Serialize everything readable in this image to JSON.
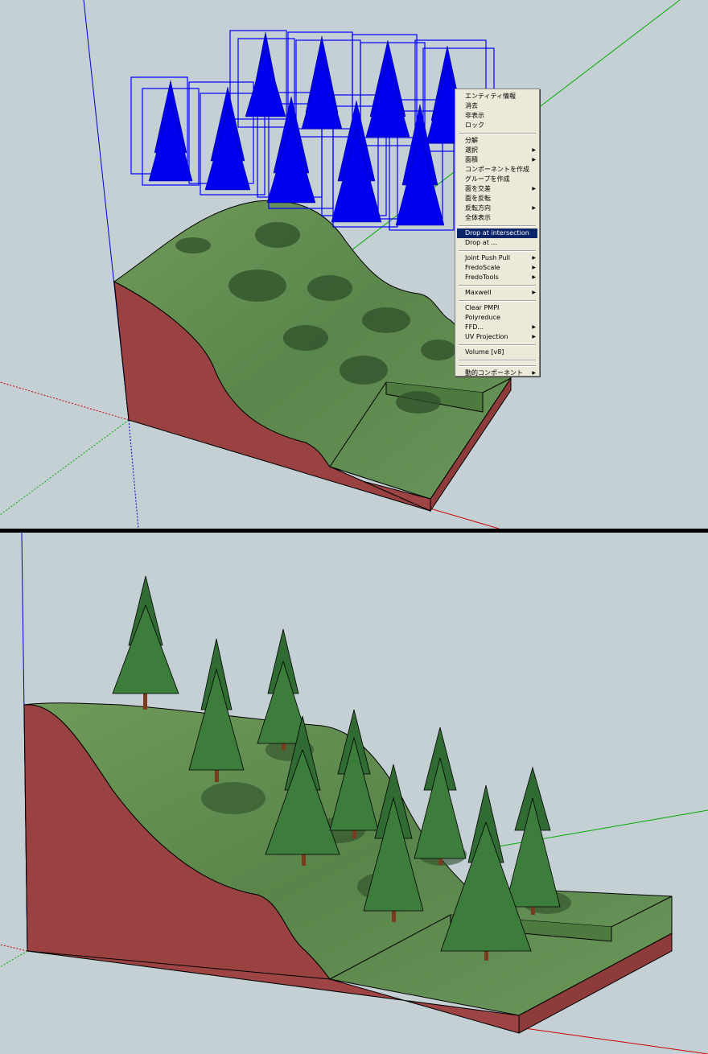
{
  "context_menu": {
    "groups": [
      [
        {
          "label": "エンティティ情報",
          "submenu": false
        },
        {
          "label": "消去",
          "submenu": false
        },
        {
          "label": "非表示",
          "submenu": false
        },
        {
          "label": "ロック",
          "submenu": false
        }
      ],
      [
        {
          "label": "分解",
          "submenu": false
        },
        {
          "label": "選択",
          "submenu": true
        },
        {
          "label": "面積",
          "submenu": true
        },
        {
          "label": "コンポーネントを作成",
          "submenu": false
        },
        {
          "label": "グループを作成",
          "submenu": false
        },
        {
          "label": "面を交差",
          "submenu": true
        },
        {
          "label": "面を反転",
          "submenu": false
        },
        {
          "label": "反転方向",
          "submenu": true
        },
        {
          "label": "全体表示",
          "submenu": false
        }
      ],
      [
        {
          "label": "Drop at intersection",
          "submenu": false,
          "highlighted": true
        },
        {
          "label": "Drop at ...",
          "submenu": false
        }
      ],
      [
        {
          "label": "Joint Push Pull",
          "submenu": true
        },
        {
          "label": "FredoScale",
          "submenu": true
        },
        {
          "label": "FredoTools",
          "submenu": true
        }
      ],
      [
        {
          "label": "Maxwell",
          "submenu": true
        }
      ],
      [
        {
          "label": "Clear PMPI",
          "submenu": false
        },
        {
          "label": "Polyreduce",
          "submenu": false
        },
        {
          "label": "FFD...",
          "submenu": true
        },
        {
          "label": "UV Projection",
          "submenu": true
        }
      ],
      [
        {
          "label": "Volume [v8]",
          "submenu": false
        }
      ],
      [],
      [
        {
          "label": "動的コンポーネント",
          "submenu": true
        }
      ]
    ]
  },
  "colors": {
    "background": "#c4d0d4",
    "terrain_side": "#9e4444",
    "terrain_top": "#5f8a4c",
    "selection": "#0000ff",
    "menu_highlight": "#0a246a",
    "axis_red": "#cc0000",
    "axis_green": "#00aa00",
    "axis_blue": "#0000cc"
  }
}
